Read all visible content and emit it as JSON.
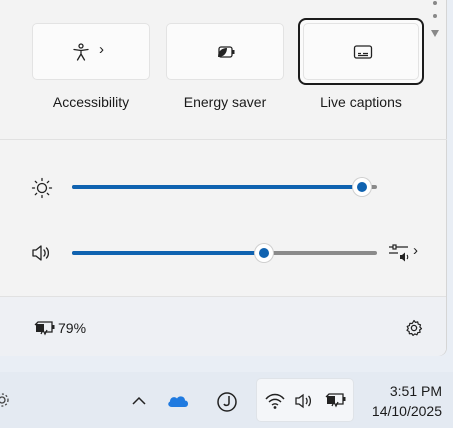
{
  "quick_settings": {
    "tiles": [
      {
        "label": "Accessibility",
        "icon": "accessibility-icon",
        "has_chevron": true,
        "active": false
      },
      {
        "label": "Energy saver",
        "icon": "energy-saver-icon",
        "has_chevron": false,
        "active": false
      },
      {
        "label": "Live captions",
        "icon": "live-captions-icon",
        "has_chevron": false,
        "active": true
      }
    ],
    "brightness": {
      "icon": "brightness-icon",
      "level": 0.95
    },
    "volume": {
      "icon": "speaker-icon",
      "level": 0.63,
      "mixer_icon": "audio-mixer-icon"
    },
    "battery": {
      "icon": "battery-charging-icon",
      "percent": "79%"
    },
    "settings_icon": "gear-icon"
  },
  "taskbar": {
    "overflow_icon": "chevron-up-icon",
    "cloud_icon": "onedrive-icon",
    "app_icon": "j-app-icon",
    "wifi_icon": "wifi-icon",
    "volume_icon": "speaker-icon",
    "battery_icon": "battery-charging-icon",
    "time": "3:51 PM",
    "date": "14/10/2025"
  },
  "colors": {
    "accent": "#0f62b0",
    "panel": "#f3f3f3",
    "taskbar": "#e4eaf2"
  }
}
